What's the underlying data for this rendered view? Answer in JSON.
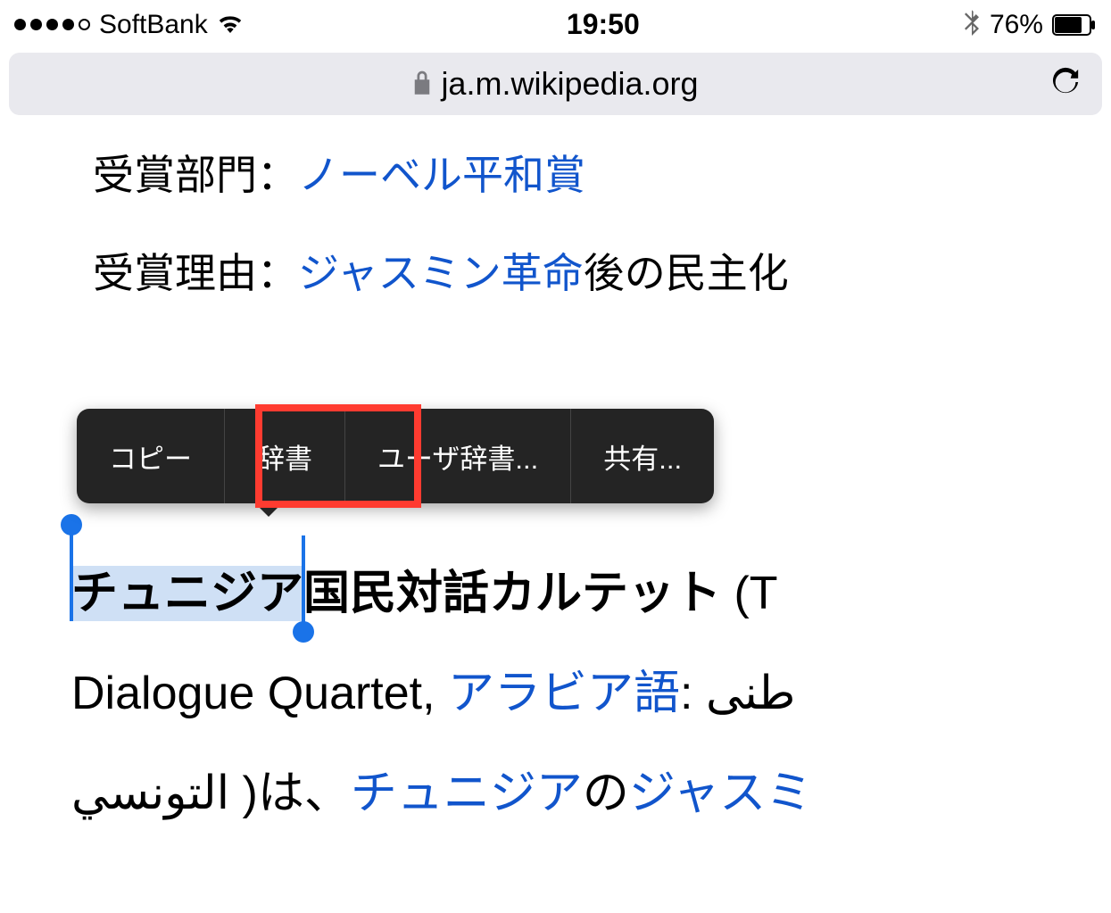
{
  "status": {
    "carrier": "SoftBank",
    "time": "19:50",
    "battery_pct": "76%"
  },
  "url_bar": {
    "domain": "ja.m.wikipedia.org"
  },
  "page": {
    "award_category_label": "受賞部門：",
    "award_category_link": "ノーベル平和賞",
    "award_reason_label": "受賞理由：",
    "award_reason_link": "ジャスミン革命",
    "award_reason_tail": "後の民主化"
  },
  "context_menu": {
    "items": [
      "コピー",
      "辞書",
      "ユーザ辞書...",
      "共有..."
    ]
  },
  "article": {
    "selected": "チュニジア",
    "bold_rest": "国民対話カルテット",
    "paren_open": " (T",
    "line2_a": "Dialogue Quartet, ",
    "line2_link": "アラビア語",
    "line2_colon": ": ",
    "line2_arabic": "طنى",
    "line3_arabic": "التونسي",
    "line3_paren": " )",
    "line3_a": "は、",
    "line3_link1": "チュニジア",
    "line3_b": "の",
    "line3_link2": "ジャスミ"
  }
}
